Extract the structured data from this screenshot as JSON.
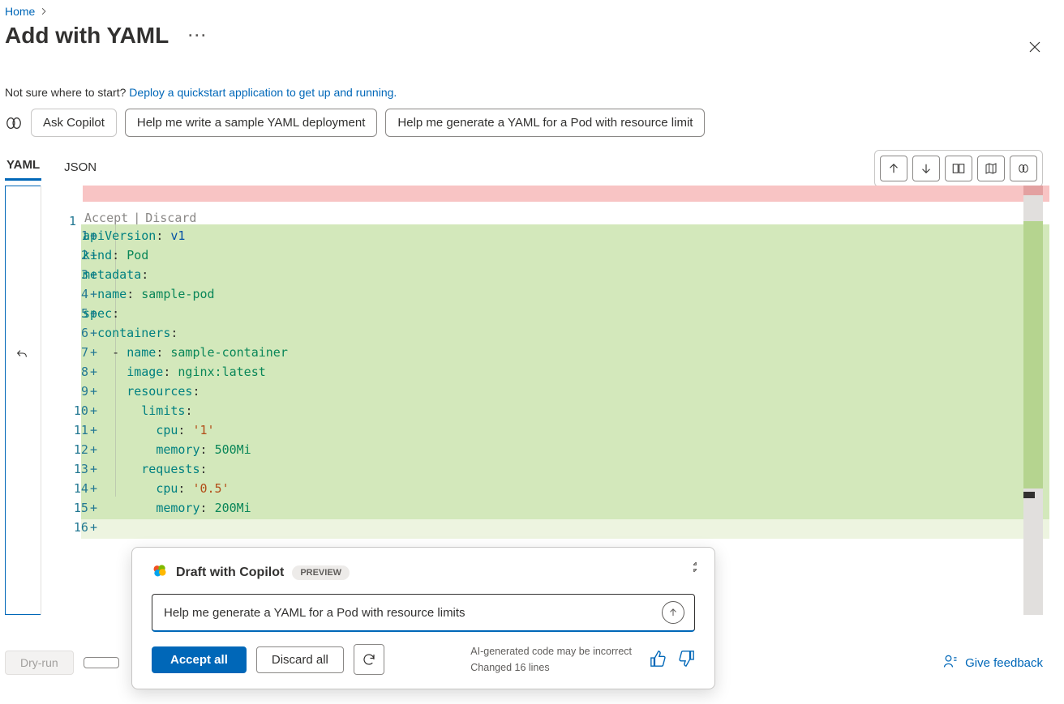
{
  "breadcrumb": {
    "home": "Home"
  },
  "title": "Add with YAML",
  "subtitle": {
    "lead": "Not sure where to start?  ",
    "link": "Deploy a quickstart application to get up and running."
  },
  "suggestions": {
    "ask": "Ask Copilot",
    "s1": "Help me write a sample YAML deployment",
    "s2": "Help me generate a YAML for a Pod with resource limit"
  },
  "tabs": {
    "yaml": "YAML",
    "json": "JSON"
  },
  "gutter": {
    "primary_line": "1"
  },
  "accept_discard": {
    "accept": "Accept",
    "discard": "Discard"
  },
  "code": {
    "lines": [
      {
        "n": "1",
        "tokens": [
          [
            "k",
            "apiVersion"
          ],
          [
            "co",
            ": "
          ],
          [
            "v",
            "v1"
          ]
        ]
      },
      {
        "n": "2",
        "tokens": [
          [
            "k",
            "kind"
          ],
          [
            "co",
            ": "
          ],
          [
            "p",
            "Pod"
          ]
        ]
      },
      {
        "n": "3",
        "tokens": [
          [
            "k",
            "metadata"
          ],
          [
            "co",
            ":"
          ]
        ]
      },
      {
        "n": "4",
        "tokens": [
          [
            "co",
            "  "
          ],
          [
            "k",
            "name"
          ],
          [
            "co",
            ": "
          ],
          [
            "p",
            "sample-pod"
          ]
        ]
      },
      {
        "n": "5",
        "tokens": [
          [
            "k",
            "spec"
          ],
          [
            "co",
            ":"
          ]
        ]
      },
      {
        "n": "6",
        "tokens": [
          [
            "co",
            "  "
          ],
          [
            "k",
            "containers"
          ],
          [
            "co",
            ":"
          ]
        ]
      },
      {
        "n": "7",
        "tokens": [
          [
            "co",
            "    - "
          ],
          [
            "k",
            "name"
          ],
          [
            "co",
            ": "
          ],
          [
            "p",
            "sample-container"
          ]
        ]
      },
      {
        "n": "8",
        "tokens": [
          [
            "co",
            "      "
          ],
          [
            "k",
            "image"
          ],
          [
            "co",
            ": "
          ],
          [
            "p",
            "nginx:latest"
          ]
        ]
      },
      {
        "n": "9",
        "tokens": [
          [
            "co",
            "      "
          ],
          [
            "k",
            "resources"
          ],
          [
            "co",
            ":"
          ]
        ]
      },
      {
        "n": "10",
        "tokens": [
          [
            "co",
            "        "
          ],
          [
            "k",
            "limits"
          ],
          [
            "co",
            ":"
          ]
        ]
      },
      {
        "n": "11",
        "tokens": [
          [
            "co",
            "          "
          ],
          [
            "k",
            "cpu"
          ],
          [
            "co",
            ": "
          ],
          [
            "s",
            "'1'"
          ]
        ]
      },
      {
        "n": "12",
        "tokens": [
          [
            "co",
            "          "
          ],
          [
            "k",
            "memory"
          ],
          [
            "co",
            ": "
          ],
          [
            "p",
            "500Mi"
          ]
        ]
      },
      {
        "n": "13",
        "tokens": [
          [
            "co",
            "        "
          ],
          [
            "k",
            "requests"
          ],
          [
            "co",
            ":"
          ]
        ]
      },
      {
        "n": "14",
        "tokens": [
          [
            "co",
            "          "
          ],
          [
            "k",
            "cpu"
          ],
          [
            "co",
            ": "
          ],
          [
            "s",
            "'0.5'"
          ]
        ]
      },
      {
        "n": "15",
        "tokens": [
          [
            "co",
            "          "
          ],
          [
            "k",
            "memory"
          ],
          [
            "co",
            ": "
          ],
          [
            "p",
            "200Mi"
          ]
        ]
      },
      {
        "n": "16",
        "tokens": []
      }
    ]
  },
  "bottom": {
    "dryrun": "Dry-run",
    "feedback": "Give feedback"
  },
  "copilot": {
    "title": "Draft with Copilot",
    "badge": "PREVIEW",
    "input": "Help me generate a YAML for a Pod with resource limits",
    "accept_all": "Accept all",
    "discard_all": "Discard all",
    "note1": "AI-generated code may be incorrect",
    "note2": "Changed 16 lines"
  }
}
